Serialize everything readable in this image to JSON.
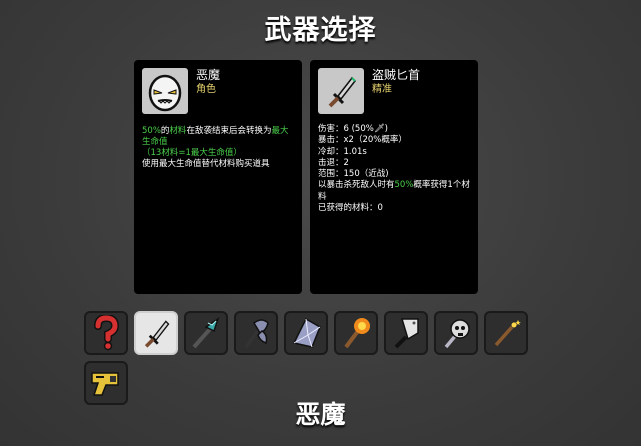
{
  "title": "武器选择",
  "character": {
    "name": "恶魔",
    "category": "角色",
    "desc_line1_a": "50%",
    "desc_line1_b": "的",
    "desc_line1_c": "材料",
    "desc_line1_d": "在敌袭结束后会转换为",
    "desc_line1_e": "最大生命值",
    "desc_line2": "（13材料=1最大生命值）",
    "desc_line3": "使用最大生命值替代材料购买道具"
  },
  "weapon": {
    "name": "盗贼匕首",
    "category": "精准",
    "stat_damage": "伤害：6 (50%🗡)",
    "stat_crit": "暴击：x2（20%概率）",
    "stat_cooldown": "冷却：1.01s",
    "stat_knockback": "击退：2",
    "stat_range": "范围：150（近战)",
    "stat_effect_a": "以暴击杀死敌人时有",
    "stat_effect_b": "50%",
    "stat_effect_c": "概率获得1个材料",
    "stat_obtained": "已获得的材料：0"
  },
  "weapon_slots": [
    {
      "icon": "random-question-icon"
    },
    {
      "icon": "thief-dagger-icon",
      "selected": true
    },
    {
      "icon": "crystal-spear-icon"
    },
    {
      "icon": "battle-axe-icon"
    },
    {
      "icon": "crystal-shard-icon"
    },
    {
      "icon": "torch-icon"
    },
    {
      "icon": "cleaver-icon"
    },
    {
      "icon": "skull-mace-icon"
    },
    {
      "icon": "magic-wand-icon"
    },
    {
      "icon": "taser-gun-icon"
    }
  ],
  "selected_character_label": "恶魔",
  "colors": {
    "highlight": "#4bd04b",
    "category": "#e7d36f",
    "panel": "#000000"
  }
}
